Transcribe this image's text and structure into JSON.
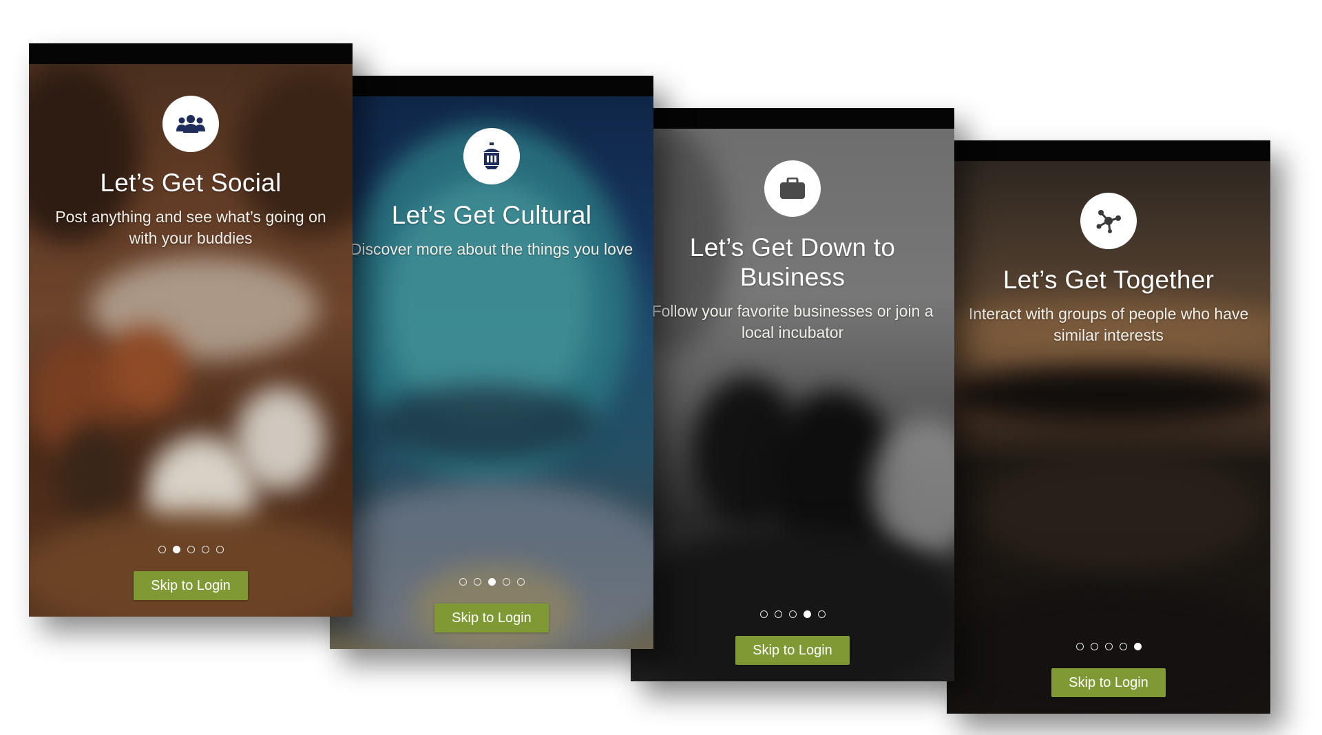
{
  "screens": [
    {
      "icon": "people-icon",
      "title": "Let’s Get Social",
      "description": "Post anything and see what’s going on with your buddies",
      "active_dot": 1,
      "skip_label": "Skip to Login"
    },
    {
      "icon": "lantern-icon",
      "title": "Let’s Get Cultural",
      "description": "Discover more about the things you love",
      "active_dot": 2,
      "skip_label": "Skip to Login"
    },
    {
      "icon": "briefcase-icon",
      "title": "Let’s Get Down to Business",
      "description": "Follow your favorite businesses or join a local incubator",
      "active_dot": 3,
      "skip_label": "Skip to Login"
    },
    {
      "icon": "network-icon",
      "title": "Let’s Get Together",
      "description": "Interact with groups of people who have similar interests",
      "active_dot": 4,
      "skip_label": "Skip to Login"
    }
  ],
  "pagination_count": 5,
  "colors": {
    "button": "#7f9a35",
    "icon": "#1f2d5a",
    "status_bar": "#050505"
  }
}
